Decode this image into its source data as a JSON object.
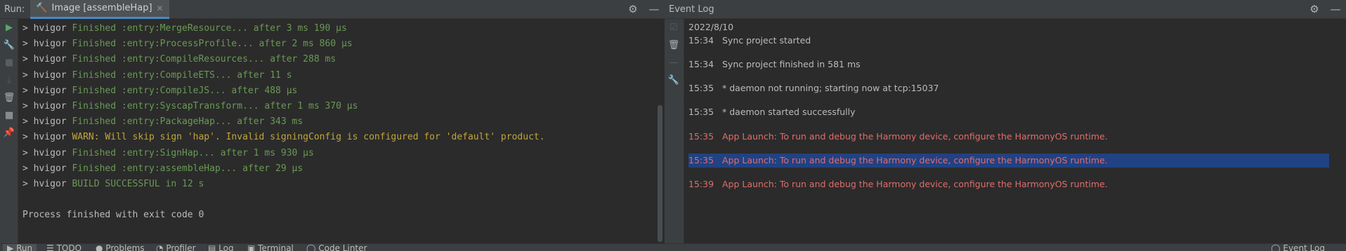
{
  "run_panel": {
    "label": "Run:",
    "tab_label": "Image [assembleHap]",
    "console_lines": [
      {
        "prompt": "> hvigor",
        "text": "Finished :entry:MergeResource... after 3 ms 190 µs",
        "color": "green"
      },
      {
        "prompt": "> hvigor",
        "text": "Finished :entry:ProcessProfile... after 2 ms 860 µs",
        "color": "green"
      },
      {
        "prompt": "> hvigor",
        "text": "Finished :entry:CompileResources... after 288 ms",
        "color": "green"
      },
      {
        "prompt": "> hvigor",
        "text": "Finished :entry:CompileETS... after 11 s",
        "color": "green"
      },
      {
        "prompt": "> hvigor",
        "text": "Finished :entry:CompileJS... after 488 µs",
        "color": "green"
      },
      {
        "prompt": "> hvigor",
        "text": "Finished :entry:SyscapTransform... after 1 ms 370 µs",
        "color": "green"
      },
      {
        "prompt": "> hvigor",
        "text": "Finished :entry:PackageHap... after 343 ms",
        "color": "green"
      },
      {
        "prompt": "> hvigor",
        "text": "WARN: Will skip sign 'hap'. Invalid signingConfig is configured for 'default' product.",
        "color": "yellow"
      },
      {
        "prompt": "> hvigor",
        "text": "Finished :entry:SignHap... after 1 ms 930 µs",
        "color": "green"
      },
      {
        "prompt": "> hvigor",
        "text": "Finished :entry:assembleHap... after 29 µs",
        "color": "green"
      },
      {
        "prompt": "> hvigor",
        "text": "BUILD SUCCESSFUL in 12 s",
        "color": "green"
      }
    ],
    "exit_message": "Process finished with exit code 0"
  },
  "event_log": {
    "title": "Event Log",
    "date": "2022/8/10",
    "events": [
      {
        "time": "15:34",
        "message": "Sync project started",
        "color": "normal",
        "selected": false
      },
      {
        "time": "15:34",
        "message": "Sync project finished in 581 ms",
        "color": "normal",
        "selected": false
      },
      {
        "time": "15:35",
        "message": "* daemon not running; starting now at tcp:15037",
        "color": "normal",
        "selected": false
      },
      {
        "time": "15:35",
        "message": "* daemon started successfully",
        "color": "normal",
        "selected": false
      },
      {
        "time": "15:35",
        "message": "App Launch: To run and debug the Harmony device, configure the HarmonyOS runtime.",
        "color": "red",
        "selected": false
      },
      {
        "time": "15:35",
        "message": "App Launch: To run and debug the Harmony device, configure the HarmonyOS runtime.",
        "color": "red",
        "selected": true
      },
      {
        "time": "15:39",
        "message": "App Launch: To run and debug the Harmony device, configure the HarmonyOS runtime.",
        "color": "red",
        "selected": false
      }
    ]
  },
  "status_bar": {
    "items": [
      {
        "icon": "▶",
        "label": "Run",
        "active": true
      },
      {
        "icon": "☰",
        "label": "TODO",
        "active": false
      },
      {
        "icon": "●",
        "label": "Problems",
        "active": false
      },
      {
        "icon": "◔",
        "label": "Profiler",
        "active": false
      },
      {
        "icon": "▤",
        "label": "Log",
        "active": false
      },
      {
        "icon": "▣",
        "label": "Terminal",
        "active": false
      },
      {
        "icon": "◯",
        "label": "Code Linter",
        "active": false
      }
    ],
    "right_label": "Event Log"
  },
  "colors": {
    "green": "#6a9955",
    "yellow": "#c1a53b",
    "red": "#e06c6c",
    "selection": "#214283"
  }
}
